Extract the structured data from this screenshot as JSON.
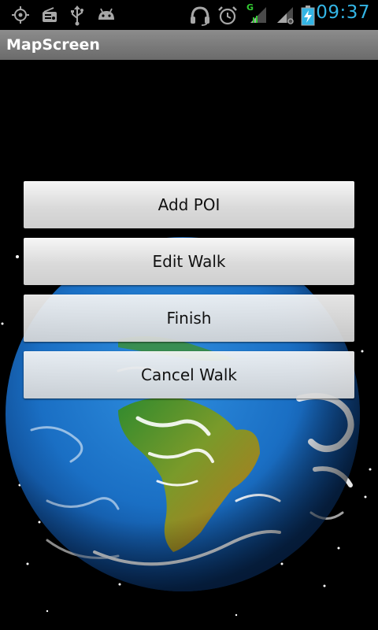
{
  "status_bar": {
    "time": "09:37",
    "network_type": "G",
    "icons": [
      "gps-icon",
      "radio-icon",
      "usb-icon",
      "android-debug-icon",
      "headset-icon",
      "alarm-icon",
      "signal-icon",
      "signal-icon",
      "battery-charging-icon"
    ],
    "accent_color": "#33b5e5"
  },
  "title_bar": {
    "title": "MapScreen"
  },
  "menu": {
    "buttons": [
      {
        "label": "Add POI"
      },
      {
        "label": "Edit Walk"
      },
      {
        "label": "Finish"
      },
      {
        "label": "Cancel Walk"
      }
    ]
  }
}
